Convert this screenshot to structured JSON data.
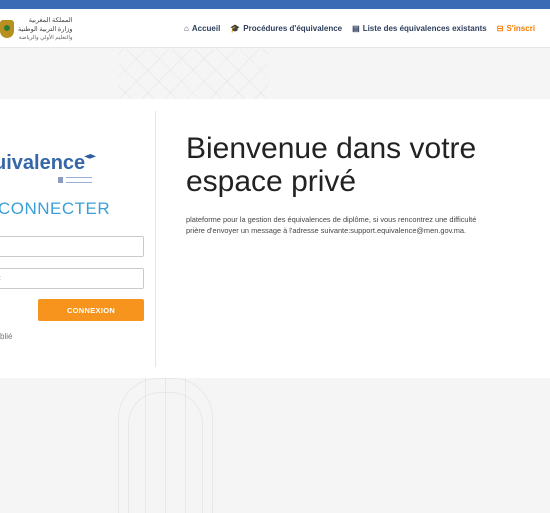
{
  "header": {
    "logo": {
      "line1": "المملكة المغربية",
      "line2": "وزارة التربية الوطنية",
      "line3": "والتعليم الأولي والرياضة"
    },
    "nav": [
      {
        "icon": "home-icon",
        "glyph": "⌂",
        "label": "Accueil"
      },
      {
        "icon": "graduation-cap-icon",
        "glyph": "🎓",
        "label": "Procédures d'équivalence"
      },
      {
        "icon": "book-icon",
        "glyph": "▤",
        "label": "Liste des équivalences existants"
      },
      {
        "icon": "register-icon",
        "glyph": "⊟",
        "label": "S'inscri"
      }
    ]
  },
  "login": {
    "brand": "uivalence",
    "title": "CONNECTER",
    "username_placeholder": "",
    "password_placeholder": ":",
    "submit_label": "CONNEXION",
    "forgot_label": "blié"
  },
  "welcome": {
    "title": "Bienvenue dans votre espace privé",
    "description": "plateforme pour la gestion des équivalences de diplôme, si vous rencontrez une difficulté prière d'envoyer un message à l'adresse suivante:support.equivalence@men.gov.ma."
  },
  "colors": {
    "accent": "#3aa0d8",
    "brand": "#3567a8",
    "button": "#f7941d",
    "nav_text": "#2e3f5c",
    "register": "#f57c00",
    "top_strip": "#3b6bb5"
  }
}
